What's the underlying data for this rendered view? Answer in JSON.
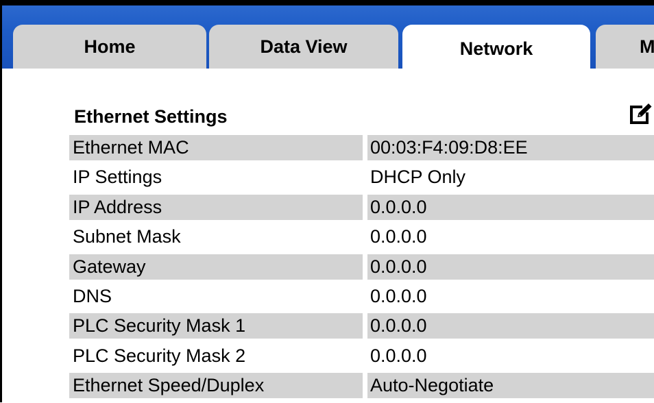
{
  "tabs": [
    {
      "label": "Home",
      "active": false
    },
    {
      "label": "Data View",
      "active": false
    },
    {
      "label": "Network",
      "active": true
    },
    {
      "label": "M",
      "active": false
    }
  ],
  "section": {
    "title": "Ethernet Settings",
    "edit_icon": "edit-icon"
  },
  "settings": [
    {
      "label": "Ethernet MAC",
      "value": "00:03:F4:09:D8:EE"
    },
    {
      "label": "IP Settings",
      "value": "DHCP Only"
    },
    {
      "label": "IP Address",
      "value": "0.0.0.0"
    },
    {
      "label": "Subnet Mask",
      "value": "0.0.0.0"
    },
    {
      "label": "Gateway",
      "value": "0.0.0.0"
    },
    {
      "label": "DNS",
      "value": "0.0.0.0"
    },
    {
      "label": "PLC Security Mask 1",
      "value": "0.0.0.0"
    },
    {
      "label": "PLC Security Mask 2",
      "value": "0.0.0.0"
    },
    {
      "label": "Ethernet Speed/Duplex",
      "value": "Auto-Negotiate"
    }
  ],
  "colors": {
    "header_blue": "#1e5cc6",
    "tab_gray": "#d2d2d2",
    "row_shade": "#d3d3d3"
  }
}
